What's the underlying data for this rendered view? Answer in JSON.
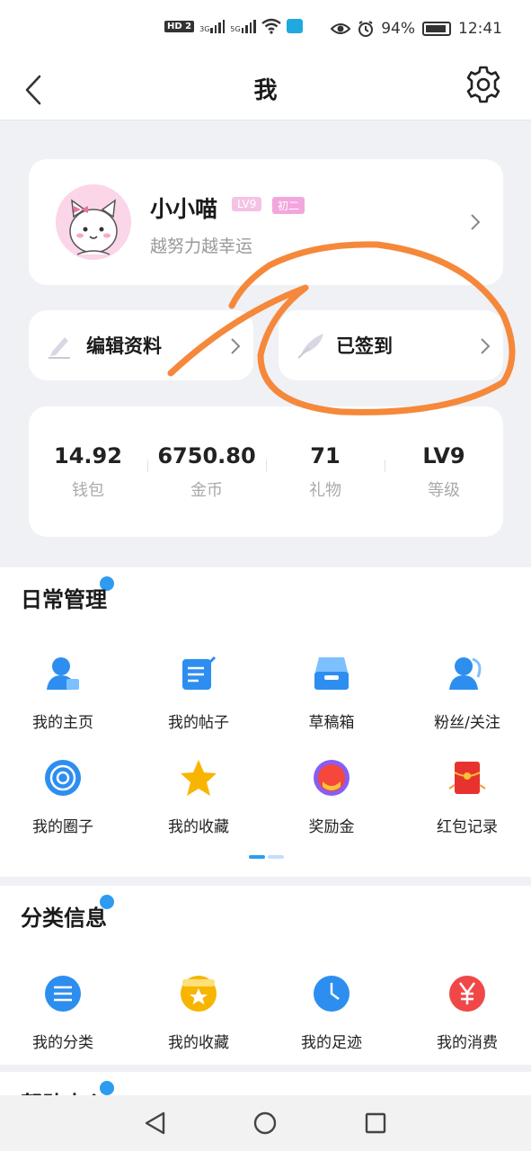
{
  "status_bar": {
    "hd": "HD",
    "hd_sub": "2",
    "sig1": "3G",
    "sig2": "5G",
    "battery": "94%",
    "time": "12:41"
  },
  "header": {
    "title": "我"
  },
  "profile": {
    "name": "小小喵",
    "level_badge": "LV9",
    "grade_badge": "初二",
    "motto": "越努力越幸运"
  },
  "actions": {
    "edit_label": "编辑资料",
    "sign_label": "已签到"
  },
  "stats": [
    {
      "value": "14.92",
      "label": "钱包"
    },
    {
      "value": "6750.80",
      "label": "金币"
    },
    {
      "value": "71",
      "label": "礼物"
    },
    {
      "value": "LV9",
      "label": "等级"
    }
  ],
  "daily": {
    "title": "日常管理",
    "items": [
      {
        "label": "我的主页",
        "icon": "user-home-icon"
      },
      {
        "label": "我的帖子",
        "icon": "post-icon"
      },
      {
        "label": "草稿箱",
        "icon": "drafts-icon"
      },
      {
        "label": "粉丝/关注",
        "icon": "followers-icon"
      },
      {
        "label": "我的圈子",
        "icon": "circle-icon"
      },
      {
        "label": "我的收藏",
        "icon": "star-icon"
      },
      {
        "label": "奖励金",
        "icon": "reward-icon"
      },
      {
        "label": "红包记录",
        "icon": "red-packet-icon"
      }
    ]
  },
  "category": {
    "title": "分类信息",
    "items": [
      {
        "label": "我的分类",
        "icon": "list-icon"
      },
      {
        "label": "我的收藏",
        "icon": "favorite-box-icon"
      },
      {
        "label": "我的足迹",
        "icon": "clock-icon"
      },
      {
        "label": "我的消费",
        "icon": "yuan-icon"
      }
    ]
  },
  "help": {
    "title": "帮助中心"
  },
  "colors": {
    "accent": "#2d9cf0",
    "annotation": "#f5883a"
  }
}
